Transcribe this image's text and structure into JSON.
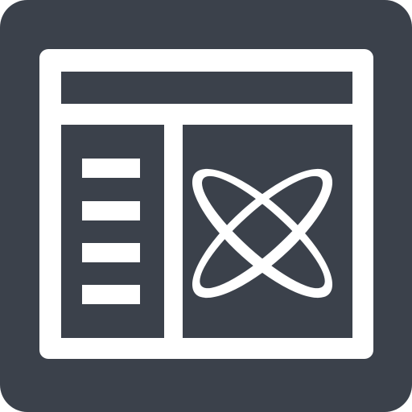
{
  "icon": {
    "name": "browser-window-with-orbit-symbol",
    "colors": {
      "background": "#3b414b",
      "foreground": "#ffffff"
    },
    "sidebar_line_count": 4
  }
}
